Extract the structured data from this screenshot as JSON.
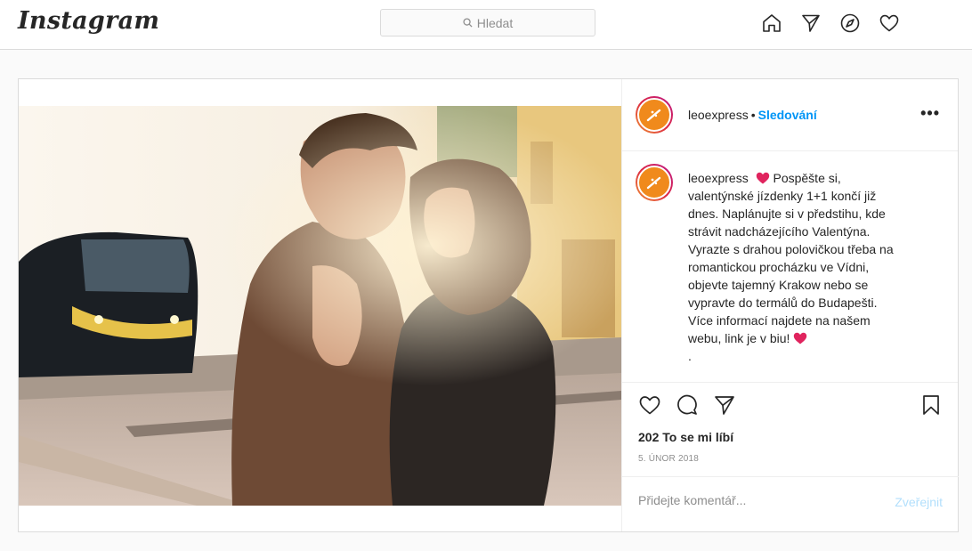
{
  "header": {
    "logo": "Instagram",
    "search": {
      "placeholder": "Hledat"
    },
    "nav": [
      "home-icon",
      "direct-icon",
      "explore-icon",
      "activity-icon"
    ]
  },
  "post": {
    "username": "leoexpress",
    "separator": "•",
    "follow_label": "Sledování",
    "more_label": "•••",
    "caption": {
      "username": "leoexpress",
      "lines": [
        "Pospěšte si,",
        "valentýnské jízdenky 1+1 končí již",
        "dnes. Naplánujte si v předstihu, kde",
        "strávit nadcházejícího Valentýna.",
        "Vyrazte s drahou polovičkou třeba na",
        "romantickou procházku ve Vídni,",
        "objevte tajemný Krakow nebo se",
        "vypravte do termálů do Budapešti.",
        "Více informací najdete na našem",
        "webu, link je v biu!"
      ],
      "last_line": "."
    },
    "likes": "202 To se mi líbí",
    "date": "5. ÚNOR 2018",
    "comment_placeholder": "Přidejte komentář...",
    "publish_label": "Zveřejnit"
  },
  "colors": {
    "accent": "#0095f6",
    "brand_orange": "#f08a1c",
    "heart": "#e0245e"
  }
}
